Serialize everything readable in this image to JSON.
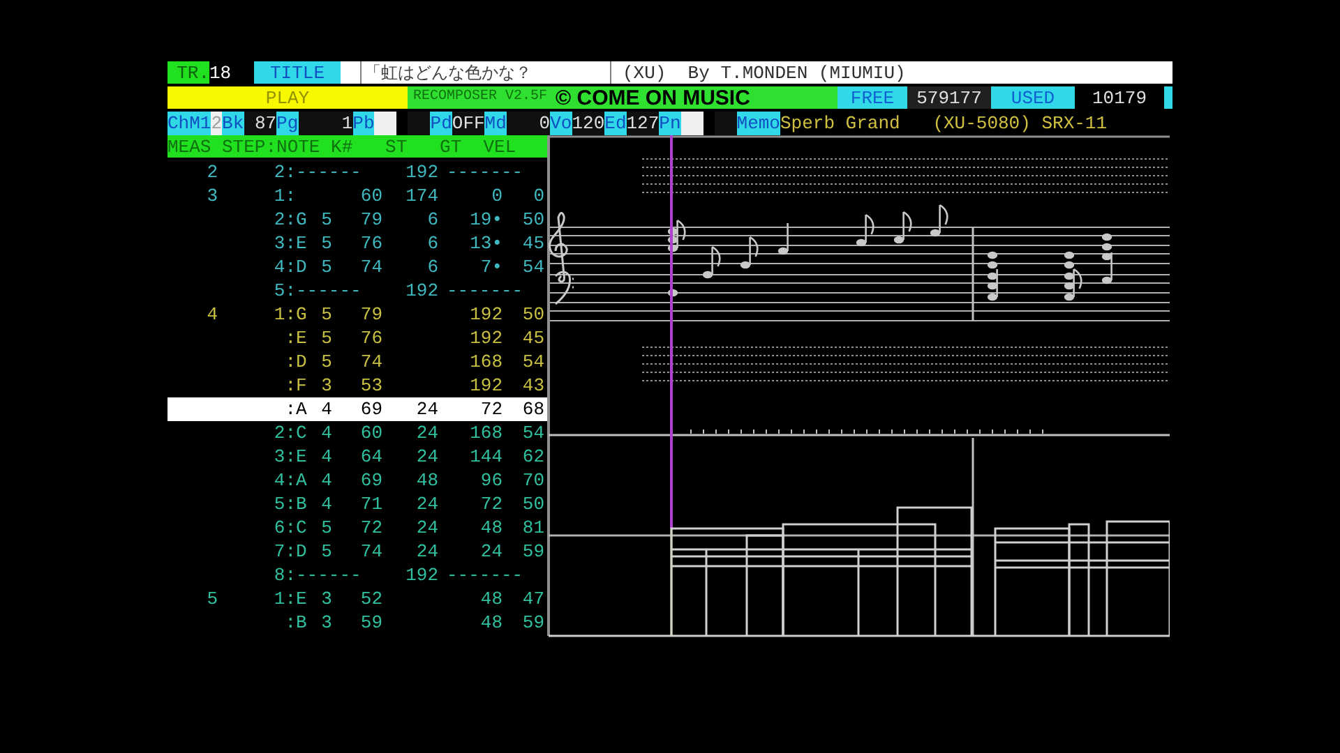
{
  "header": {
    "track_label": "TR.",
    "track": "18",
    "title_label": "TITLE",
    "title": "「虹はどんな色かな？",
    "credit": "(XU)  By T.MONDEN (MIUMIU)"
  },
  "status": {
    "mode": "PLAY",
    "version": "RECOMPOSER V2.5F",
    "copyright": "© COME ON MUSIC",
    "free_label": "FREE",
    "free": "579177",
    "used_label": "USED",
    "used": "10179"
  },
  "params": [
    {
      "kind": "label",
      "text": "ChM1"
    },
    {
      "kind": "blank",
      "text": "2"
    },
    {
      "kind": "label",
      "text": "Bk"
    },
    {
      "kind": "value",
      "text": " 87"
    },
    {
      "kind": "label",
      "text": "Pg"
    },
    {
      "kind": "value",
      "text": "    1"
    },
    {
      "kind": "label",
      "text": "Pb"
    },
    {
      "kind": "white_box"
    },
    {
      "kind": "black_box"
    },
    {
      "kind": "label",
      "text": "Pd"
    },
    {
      "kind": "value",
      "text": "OFF"
    },
    {
      "kind": "label",
      "text": "Md"
    },
    {
      "kind": "value",
      "text": "   0"
    },
    {
      "kind": "label",
      "text": "Vo"
    },
    {
      "kind": "value",
      "text": "120"
    },
    {
      "kind": "label",
      "text": "Ed"
    },
    {
      "kind": "value",
      "text": "127"
    },
    {
      "kind": "label",
      "text": "Pn"
    },
    {
      "kind": "white_box"
    },
    {
      "kind": "black_box"
    },
    {
      "kind": "label",
      "text": "Memo"
    },
    {
      "kind": "memo",
      "text": "Sperb Grand   (XU-5080) SRX-11"
    }
  ],
  "columns_header": "MEAS STEP:NOTE K#   ST   GT  VEL",
  "events": [
    {
      "kind": "separator",
      "meas": "2",
      "step": "2:",
      "dash": "------",
      "st": "192",
      "dash2": "-------",
      "color": "#40b8c0",
      "selected": false
    },
    {
      "kind": "note",
      "meas": "3",
      "step": "1:",
      "key": "60",
      "st": "174",
      "gt": "0",
      "vel": "0",
      "color": "#40b8c0",
      "selected": false
    },
    {
      "kind": "note",
      "step": "2:",
      "note": "G",
      "oct": "5",
      "key": "79",
      "st": "6",
      "gt": "19•",
      "vel": "50",
      "color": "#40b8c0",
      "selected": false
    },
    {
      "kind": "note",
      "step": "3:",
      "note": "E",
      "oct": "5",
      "key": "76",
      "st": "6",
      "gt": "13•",
      "vel": "45",
      "color": "#40b8c0",
      "selected": false
    },
    {
      "kind": "note",
      "step": "4:",
      "note": "D",
      "oct": "5",
      "key": "74",
      "st": "6",
      "gt": "7•",
      "vel": "54",
      "color": "#40b8c0",
      "selected": false
    },
    {
      "kind": "separator",
      "step": "5:",
      "dash": "------",
      "st": "192",
      "dash2": "-------",
      "color": "#40b8c0",
      "selected": false
    },
    {
      "kind": "note",
      "meas": "4",
      "step": "1:",
      "note": "G",
      "oct": "5",
      "key": "79",
      "gt": "192",
      "vel": "50",
      "color": "#c8c040",
      "selected": false
    },
    {
      "kind": "note",
      "step": ":",
      "note": "E",
      "oct": "5",
      "key": "76",
      "gt": "192",
      "vel": "45",
      "color": "#c8c040",
      "selected": false
    },
    {
      "kind": "note",
      "step": ":",
      "note": "D",
      "oct": "5",
      "key": "74",
      "gt": "168",
      "vel": "54",
      "color": "#c8c040",
      "selected": false
    },
    {
      "kind": "note",
      "step": ":",
      "note": "F",
      "oct": "3",
      "key": "53",
      "gt": "192",
      "vel": "43",
      "color": "#c8c040",
      "selected": false
    },
    {
      "kind": "note",
      "step": ":",
      "note": "A",
      "oct": "4",
      "key": "69",
      "st": "24",
      "gt": "72",
      "vel": "68",
      "selected": true
    },
    {
      "kind": "note",
      "step": "2:",
      "note": "C",
      "oct": "4",
      "key": "60",
      "st": "24",
      "gt": "168",
      "vel": "54",
      "color": "#30c0a0",
      "selected": false
    },
    {
      "kind": "note",
      "step": "3:",
      "note": "E",
      "oct": "4",
      "key": "64",
      "st": "24",
      "gt": "144",
      "vel": "62",
      "color": "#30c0a0",
      "selected": false
    },
    {
      "kind": "note",
      "step": "4:",
      "note": "A",
      "oct": "4",
      "key": "69",
      "st": "48",
      "gt": "96",
      "vel": "70",
      "color": "#30c0a0",
      "selected": false
    },
    {
      "kind": "note",
      "step": "5:",
      "note": "B",
      "oct": "4",
      "key": "71",
      "st": "24",
      "gt": "72",
      "vel": "50",
      "color": "#30c0a0",
      "selected": false
    },
    {
      "kind": "note",
      "step": "6:",
      "note": "C",
      "oct": "5",
      "key": "72",
      "st": "24",
      "gt": "48",
      "vel": "81",
      "color": "#30c0a0",
      "selected": false
    },
    {
      "kind": "note",
      "step": "7:",
      "note": "D",
      "oct": "5",
      "key": "74",
      "st": "24",
      "gt": "24",
      "vel": "59",
      "color": "#30c0a0",
      "selected": false
    },
    {
      "kind": "separator",
      "step": "8:",
      "dash": "------",
      "st": "192",
      "dash2": "-------",
      "color": "#30c0a0",
      "selected": false
    },
    {
      "kind": "note",
      "meas": "5",
      "step": "1:",
      "note": "E",
      "oct": "3",
      "key": "52",
      "gt": "48",
      "vel": "47",
      "color": "#30c0a0",
      "selected": false
    },
    {
      "kind": "note",
      "step": ":",
      "note": "B",
      "oct": "3",
      "key": "59",
      "gt": "48",
      "vel": "59",
      "color": "#30c0a0",
      "selected": false
    }
  ]
}
